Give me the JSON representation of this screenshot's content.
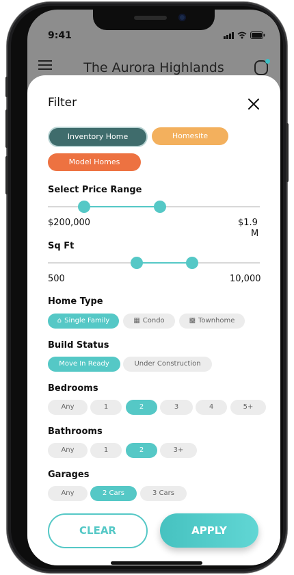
{
  "status_bar": {
    "time": "9:41"
  },
  "background": {
    "title": "The Aurora Highlands"
  },
  "filter": {
    "title": "Filter",
    "community_types": [
      {
        "label": "Inventory Home",
        "color": "#3f6c6c",
        "selected": true
      },
      {
        "label": "Homesite",
        "color": "#f3b05d"
      },
      {
        "label": "Model Homes",
        "color": "#ed7241"
      }
    ],
    "price": {
      "heading": "Select Price Range",
      "min_label": "$200,000",
      "max_label_line1": "$1.9",
      "max_label_line2": "M",
      "low_level": 0.17,
      "high_level": 0.53
    },
    "sqft": {
      "heading": "Sq Ft",
      "min_label": "500",
      "max_label": "10,000",
      "low_level": 0.42,
      "high_level": 0.68
    },
    "home_type": {
      "heading": "Home Type",
      "options": [
        {
          "label": "Single Family",
          "icon": "home-icon",
          "selected": true
        },
        {
          "label": "Condo",
          "icon": "building-icon"
        },
        {
          "label": "Townhome",
          "icon": "townhome-icon"
        }
      ]
    },
    "build_status": {
      "heading": "Build Status",
      "options": [
        {
          "label": "Move In Ready",
          "selected": true
        },
        {
          "label": "Under Construction"
        }
      ]
    },
    "bedrooms": {
      "heading": "Bedrooms",
      "options": [
        "Any",
        "1",
        "2",
        "3",
        "4",
        "5+"
      ],
      "selected": "2"
    },
    "bathrooms": {
      "heading": "Bathrooms",
      "options": [
        "Any",
        "1",
        "2",
        "3+"
      ],
      "selected": "2"
    },
    "garages": {
      "heading": "Garages",
      "options": [
        "Any",
        "2 Cars",
        "3 Cars"
      ],
      "selected": "2 Cars"
    },
    "clear_label": "CLEAR",
    "apply_label": "APPLY"
  },
  "colors": {
    "accent": "#55c8c6",
    "dark_teal": "#3f6c6c",
    "orange": "#f3b05d",
    "red_orange": "#ed7241"
  }
}
